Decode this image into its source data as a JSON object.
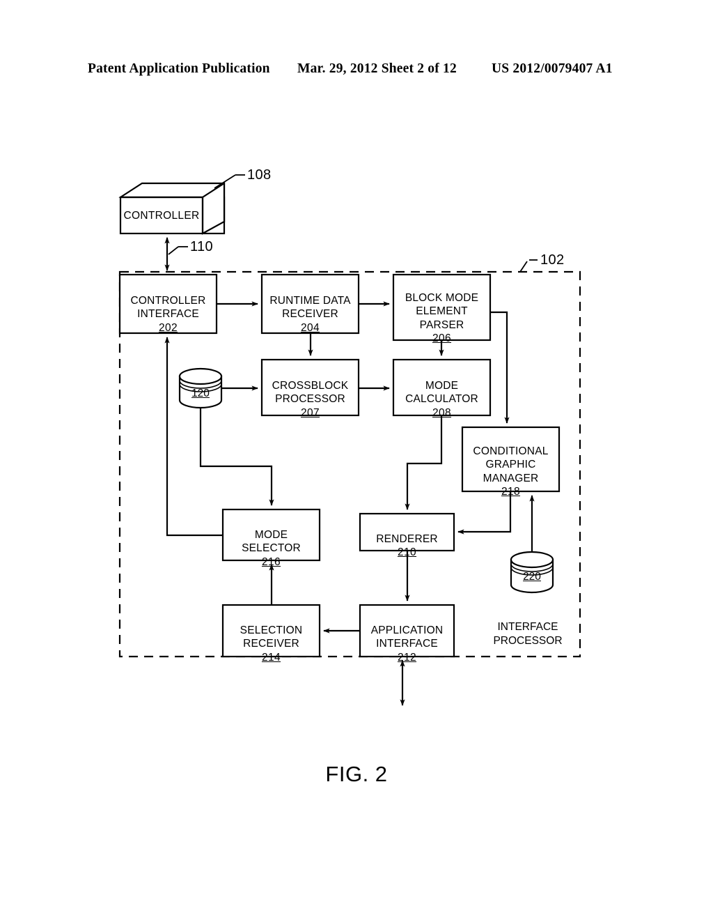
{
  "header": {
    "left": "Patent Application Publication",
    "middle": "Mar. 29, 2012  Sheet 2 of 12",
    "right": "US 2012/0079407 A1"
  },
  "figure": {
    "caption": "FIG. 2",
    "system_label": "102",
    "container_label": "INTERFACE\nPROCESSOR"
  },
  "controller": {
    "label": "CONTROLLER",
    "ref": "108",
    "link_ref": "110"
  },
  "blocks": [
    {
      "id": "controller-interface",
      "title": "CONTROLLER\nINTERFACE",
      "num": "202"
    },
    {
      "id": "runtime-data-receiver",
      "title": "RUNTIME DATA\nRECEIVER",
      "num": "204"
    },
    {
      "id": "block-mode-element-parser",
      "title": "BLOCK  MODE\nELEMENT\nPARSER",
      "num": "206"
    },
    {
      "id": "crossblock-processor",
      "title": "CROSSBLOCK\nPROCESSOR",
      "num": "207"
    },
    {
      "id": "mode-calculator",
      "title": "MODE\nCALCULATOR",
      "num": "208"
    },
    {
      "id": "conditional-graphic-manager",
      "title": "CONDITIONAL\nGRAPHIC\nMANAGER",
      "num": "218"
    },
    {
      "id": "mode-selector",
      "title": "MODE\nSELECTOR",
      "num": "216"
    },
    {
      "id": "renderer",
      "title": "RENDERER",
      "num": "210"
    },
    {
      "id": "selection-receiver",
      "title": "SELECTION\nRECEIVER",
      "num": "214"
    },
    {
      "id": "application-interface",
      "title": "APPLICATION\nINTERFACE",
      "num": "212"
    }
  ],
  "datastores": [
    {
      "id": "datastore-120",
      "num": "120"
    },
    {
      "id": "datastore-220",
      "num": "220"
    }
  ],
  "colors": {
    "ink": "#000000",
    "paper": "#ffffff"
  }
}
